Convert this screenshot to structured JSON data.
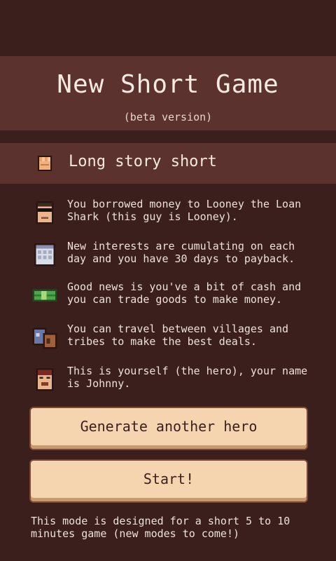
{
  "header": {
    "title": "New Short Game",
    "subtitle": "(beta version)"
  },
  "section": {
    "title": "Long story short",
    "icon": "fist-icon"
  },
  "story": [
    {
      "icon": "loan-shark-icon",
      "text": "You borrowed money to Looney the Loan Shark (this guy is Looney)."
    },
    {
      "icon": "calendar-icon",
      "text": "New interests are cumulating on each day and you have 30 days to payback."
    },
    {
      "icon": "cash-icon",
      "text": "Good news is you've a bit of cash and you can trade goods to make money."
    },
    {
      "icon": "village-icon",
      "text": "You can travel between villages and tribes to make the best deals."
    },
    {
      "icon": "hero-icon",
      "text": "This is yourself (the hero), your name is Johnny."
    }
  ],
  "buttons": {
    "generate_label": "Generate another hero",
    "start_label": "Start!"
  },
  "footer": {
    "note": "This mode is designed for a short 5 to 10 minutes game (new modes to come!)"
  },
  "colors": {
    "background": "#3b1f1c",
    "band": "#5b322d",
    "button": "#f5d5b0",
    "button_shadow": "#c79a6d"
  }
}
